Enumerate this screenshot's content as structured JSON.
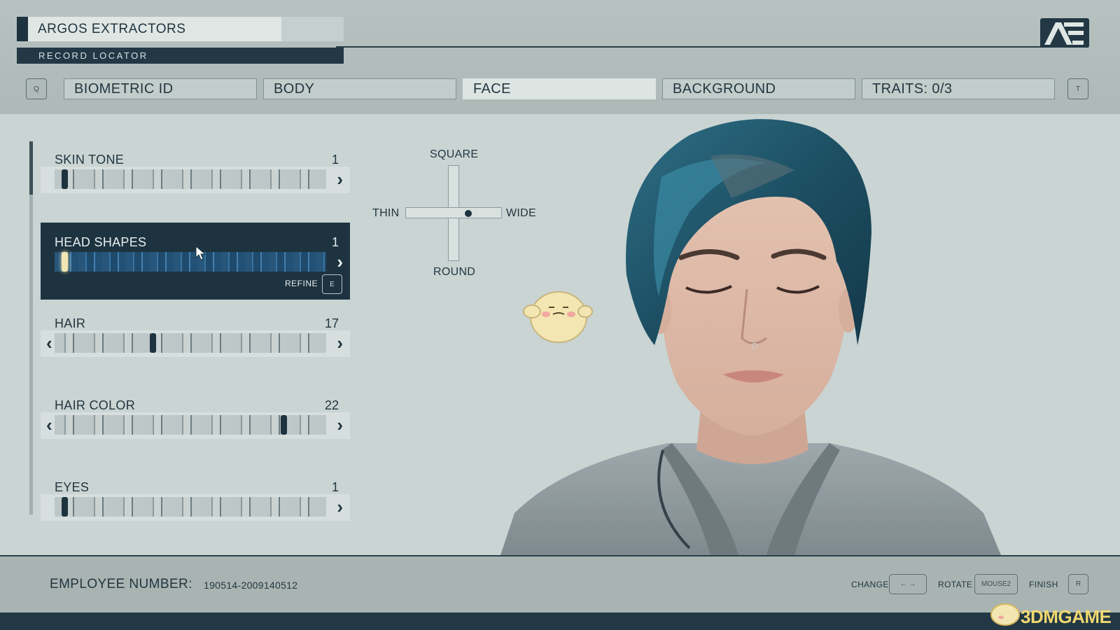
{
  "header": {
    "company": "ARGOS EXTRACTORS",
    "record_label": "RECORD LOCATOR",
    "logo_text": "AE",
    "prev_key": "Q",
    "next_key": "T"
  },
  "tabs": [
    {
      "label": "BIOMETRIC ID",
      "active": false
    },
    {
      "label": "BODY",
      "active": false
    },
    {
      "label": "FACE",
      "active": true
    },
    {
      "label": "BACKGROUND",
      "active": false
    },
    {
      "label": "TRAITS: 0/3",
      "active": false
    }
  ],
  "sliders": [
    {
      "label": "SKIN TONE",
      "value": "1",
      "position": 0.0,
      "left_arrow": false,
      "selected": false
    },
    {
      "label": "HEAD SHAPES",
      "value": "1",
      "position": 0.0,
      "left_arrow": false,
      "selected": true
    },
    {
      "label": "HAIR",
      "value": "17",
      "position": 0.37,
      "left_arrow": true,
      "selected": false
    },
    {
      "label": "HAIR COLOR",
      "value": "22",
      "position": 0.92,
      "left_arrow": true,
      "selected": false
    },
    {
      "label": "EYES",
      "value": "1",
      "position": 0.0,
      "left_arrow": false,
      "selected": false
    }
  ],
  "refine": {
    "label": "REFINE",
    "key": "E"
  },
  "shape_control": {
    "top": "SQUARE",
    "bottom": "ROUND",
    "left": "THIN",
    "right": "WIDE",
    "value_horizontal": 0.65,
    "value_vertical": 0.5
  },
  "footer": {
    "employee_label": "EMPLOYEE NUMBER:",
    "employee_number": "190514-2009140512",
    "controls": [
      {
        "label": "CHANGE",
        "key": "← →"
      },
      {
        "label": "ROTATE",
        "key": "MOUSE2"
      },
      {
        "label": "FINISH",
        "key": "R"
      }
    ]
  },
  "watermark": "3DMGAME",
  "colors": {
    "dark_panel": "#1e3340",
    "background": "#c9d4d3",
    "accent_blue": "#3c7fb3",
    "knob_glow": "#f2e6b5"
  }
}
